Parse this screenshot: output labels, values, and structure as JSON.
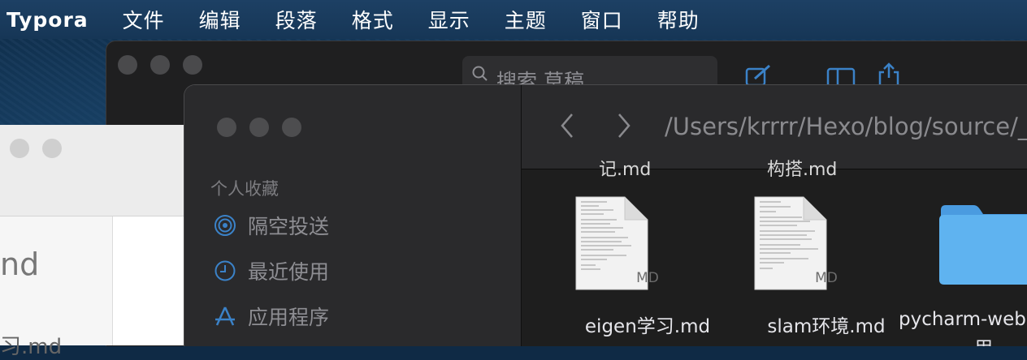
{
  "menubar": {
    "app_name": "Typora",
    "items": [
      "文件",
      "编辑",
      "段落",
      "格式",
      "显示",
      "主题",
      "窗口",
      "帮助"
    ]
  },
  "back_window": {
    "search_placeholder": "搜索 草稿",
    "icons": [
      "compose-icon",
      "sidebar-toggle-icon",
      "share-icon"
    ]
  },
  "light_window": {
    "partial_text_1": "nd",
    "partial_text_2": "习.md"
  },
  "finder": {
    "sidebar": {
      "section_title": "个人收藏",
      "items": [
        {
          "label": "隔空投送",
          "icon": "airdrop-icon"
        },
        {
          "label": "最近使用",
          "icon": "clock-icon"
        },
        {
          "label": "应用程序",
          "icon": "applications-icon"
        }
      ]
    },
    "path": "/Users/krrrr/Hexo/blog/source/_",
    "cutoff_labels": [
      "记.md",
      "构搭.md"
    ],
    "files": [
      {
        "name": "eigen学习.md",
        "badge": "MD"
      },
      {
        "name": "slam环境.md",
        "badge": "MD"
      }
    ],
    "folder": {
      "name_line1": "pycharm-web",
      "name_line2": "用"
    }
  },
  "colors": {
    "accent_blue": "#3b82c8",
    "folder_blue": "#5fb3f0"
  }
}
